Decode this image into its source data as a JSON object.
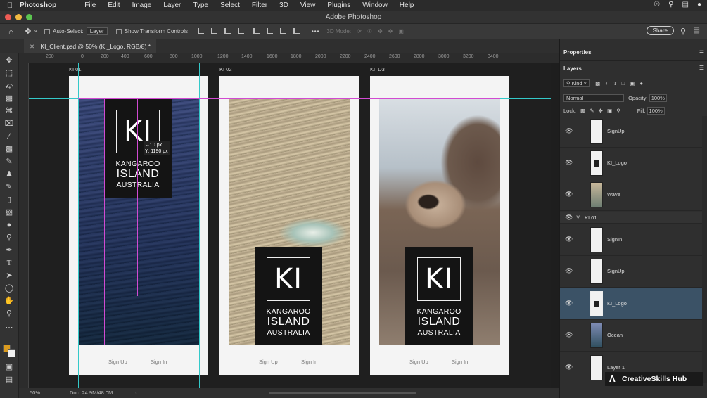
{
  "menubar": {
    "app": "Photoshop",
    "items": [
      "File",
      "Edit",
      "Image",
      "Layer",
      "Type",
      "Select",
      "Filter",
      "3D",
      "View",
      "Plugins",
      "Window",
      "Help"
    ]
  },
  "window": {
    "title": "Adobe Photoshop"
  },
  "options": {
    "auto_select_label": "Auto-Select:",
    "auto_select_value": "Layer",
    "transform_label": "Show Transform Controls",
    "mode_3d": "3D Mode:",
    "share_label": "Share"
  },
  "doc_tab": {
    "label": "KI_Client.psd @ 50% (KI_Logo, RGB/8) *"
  },
  "ruler": {
    "ticks": [
      "200",
      "0",
      "200",
      "400",
      "600",
      "800",
      "1000",
      "1200",
      "1400",
      "1600",
      "1800",
      "2000",
      "2200",
      "2400",
      "2600",
      "2800",
      "3000",
      "3200",
      "3400"
    ]
  },
  "artboards": [
    {
      "label": "KI 01",
      "sign_up": "Sign Up",
      "sign_in": "Sign In"
    },
    {
      "label": "KI 02",
      "sign_up": "Sign Up",
      "sign_in": "Sign In"
    },
    {
      "label": "KI_D3",
      "sign_up": "Sign Up",
      "sign_in": "Sign In"
    }
  ],
  "logo": {
    "mark": "KI",
    "line1": "KANGAROO",
    "line2": "ISLAND",
    "line3": "AUSTRALIA"
  },
  "smart_guide": {
    "dx": "0 px",
    "dy": "1190 px"
  },
  "status": {
    "zoom": "50%",
    "doc": "Doc: 24.9M/48.0M"
  },
  "panels": {
    "properties_tab": "Properties",
    "layers_tab": "Layers",
    "kind_filter": "Kind",
    "blend_mode": "Normal",
    "opacity_label": "Opacity:",
    "opacity_value": "100%",
    "lock_label": "Lock:",
    "fill_label": "Fill:",
    "fill_value": "100%",
    "layers_top": [
      "SignUp",
      "KI_Logo",
      "Wave"
    ],
    "group_name": "KI 01",
    "layers_group": [
      "SignIn",
      "SignUp",
      "KI_Logo",
      "Ocean",
      "Layer 1"
    ]
  },
  "watermark": "CreativeSkills Hub",
  "colors": {
    "guide_cyan": "#34c9c9",
    "guide_magenta": "#d14ad1",
    "selected_layer": "#3b5266"
  }
}
